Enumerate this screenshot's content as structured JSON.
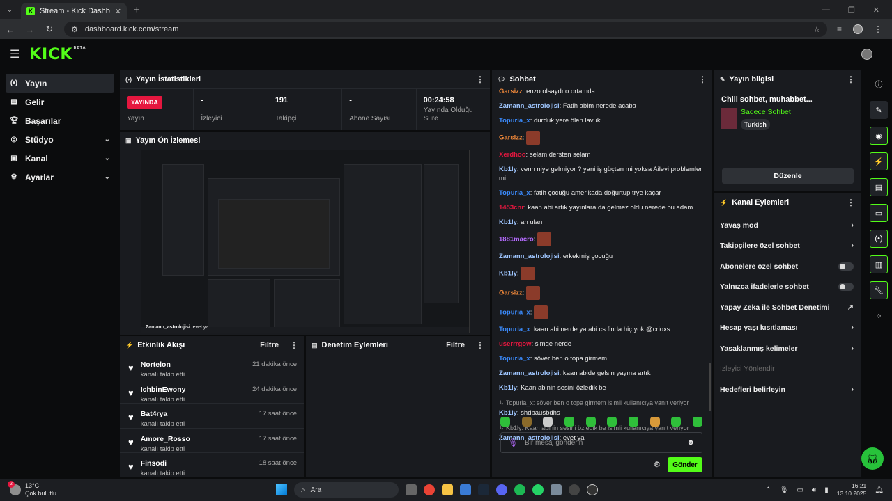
{
  "browser": {
    "tab_title": "Stream - Kick Dashboard",
    "url": "dashboard.kick.com/stream"
  },
  "header": {
    "logo": "KICK",
    "logo_sup": "BETA"
  },
  "sidebar": {
    "items": [
      {
        "label": "Yayın",
        "icon": "broadcast-icon"
      },
      {
        "label": "Gelir",
        "icon": "revenue-icon"
      },
      {
        "label": "Başarılar",
        "icon": "trophy-icon"
      },
      {
        "label": "Stüdyo",
        "icon": "studio-icon"
      },
      {
        "label": "Kanal",
        "icon": "channel-icon"
      },
      {
        "label": "Ayarlar",
        "icon": "settings-icon"
      }
    ]
  },
  "stats": {
    "title": "Yayın İstatistikleri",
    "live_badge": "YAYINDA",
    "live_label": "Yayın",
    "viewers_value": "-",
    "viewers_label": "İzleyici",
    "followers_value": "191",
    "followers_label": "Takipçi",
    "subs_value": "-",
    "subs_label": "Abone Sayısı",
    "uptime_value": "00:24:58",
    "uptime_label": "Yayında Olduğu Süre"
  },
  "preview": {
    "title": "Yayın Ön İzlemesi",
    "overlay_user": "Zamann_astrolojisi",
    "overlay_msg": ": evet ya"
  },
  "events": {
    "title": "Etkinlik Akışı",
    "filter": "Filtre",
    "items": [
      {
        "name": "Nortelon",
        "sub": "kanalı takip etti",
        "time": "21 dakika önce"
      },
      {
        "name": "IchbinEwony",
        "sub": "kanalı takip etti",
        "time": "24 dakika önce"
      },
      {
        "name": "Bat4rya",
        "sub": "kanalı takip etti",
        "time": "17 saat önce"
      },
      {
        "name": "Amore_Rosso",
        "sub": "kanalı takip etti",
        "time": "17 saat önce"
      },
      {
        "name": "Finsodi",
        "sub": "kanalı takip etti",
        "time": "18 saat önce"
      }
    ]
  },
  "moderation": {
    "title": "Denetim Eylemleri",
    "filter": "Filtre"
  },
  "chat": {
    "title": "Sohbet",
    "placeholder": "Bir mesaj gönderin",
    "send": "Gönder",
    "messages": [
      {
        "user": "Garsizz",
        "color": "#f0883a",
        "text": "enzo olsaydı o ortamda"
      },
      {
        "user": "Zamann_astrolojisi",
        "color": "#9fc6ff",
        "text": "Fatih abim nerede acaba"
      },
      {
        "user": "Topuria_x",
        "color": "#3b8cff",
        "text": "durduk yere ölen lavuk"
      },
      {
        "user": "Garsizz",
        "color": "#f0883a",
        "text": "",
        "emote": true
      },
      {
        "user": "Xerdhoo",
        "color": "#e5173f",
        "text": "selam dersten selam"
      },
      {
        "user": "Kb1ly",
        "color": "#9fc6ff",
        "text": "venn niye gelmiyor ? yani iş güçten mi yoksa Ailevi problemler mi"
      },
      {
        "user": "Topuria_x",
        "color": "#3b8cff",
        "text": "fatih çocuğu amerikada doğurtup trye kaçar"
      },
      {
        "user": "1453cnr",
        "color": "#e5173f",
        "text": "kaan abi artık yayınlara da gelmez oldu nerede bu adam"
      },
      {
        "user": "Kb1ly",
        "color": "#9fc6ff",
        "text": "ah ulan"
      },
      {
        "user": "1881macro",
        "color": "#b56bff",
        "text": "",
        "emote": true
      },
      {
        "user": "Zamann_astrolojisi",
        "color": "#9fc6ff",
        "text": "erkekmiş çocuğu"
      },
      {
        "user": "Kb1ly",
        "color": "#9fc6ff",
        "text": "",
        "emote": true
      },
      {
        "user": "Garsizz",
        "color": "#f0883a",
        "text": "",
        "emote": true
      },
      {
        "user": "Topuria_x",
        "color": "#3b8cff",
        "text": "",
        "emote": true
      },
      {
        "user": "Topuria_x",
        "color": "#3b8cff",
        "text": "kaan abi nerde ya abi cs finda hiç yok @crioxs"
      },
      {
        "user": "userrrgow",
        "color": "#e5173f",
        "text": "simge nerde"
      },
      {
        "user": "Topuria_x",
        "color": "#3b8cff",
        "text": "söver ben o topa girmem"
      },
      {
        "user": "Zamann_astrolojisi",
        "color": "#9fc6ff",
        "text": "kaan abide gelsin yayına artık"
      },
      {
        "user": "Kb1ly",
        "color": "#9fc6ff",
        "text": "Kaan abinin sesini özledik be"
      }
    ],
    "reply1": "Topuria_x: söver ben o topa girmem isimli kullanıcıya yanıt veriyor",
    "reply1_user": "Kb1ly",
    "reply1_text": "shdbausbdhs",
    "reply2": "Kb1ly: Kaan abinin sesini özledik be isimli kullanıcıya yanıt veriyor",
    "reply2_user": "Zamann_astrolojisi",
    "reply2_text": "evet ya"
  },
  "info": {
    "title": "Yayın bilgisi",
    "stream_title": "Chill sohbet, muhabbet...",
    "category": "Sadece Sohbet",
    "tag": "Turkish",
    "edit": "Düzenle"
  },
  "channel_actions": {
    "title": "Kanal Eylemleri",
    "items": [
      {
        "label": "Yavaş mod",
        "type": "arrow"
      },
      {
        "label": "Takipçilere özel sohbet",
        "type": "arrow"
      },
      {
        "label": "Abonelere özel sohbet",
        "type": "toggle"
      },
      {
        "label": "Yalnızca ifadelerle sohbet",
        "type": "toggle"
      },
      {
        "label": "Yapay Zeka ile Sohbet Denetimi",
        "type": "external"
      },
      {
        "label": "Hesap yaşı kısıtlaması",
        "type": "arrow"
      },
      {
        "label": "Yasaklanmış kelimeler",
        "type": "arrow"
      },
      {
        "label": "İzleyici Yönlendir",
        "type": "dim"
      },
      {
        "label": "Hedefleri belirleyin",
        "type": "arrow"
      }
    ]
  },
  "taskbar": {
    "temp": "13°C",
    "weather": "Çok bulutlu",
    "weather_badge": "2",
    "search": "Ara",
    "time": "16:21",
    "date": "13.10.2025"
  }
}
